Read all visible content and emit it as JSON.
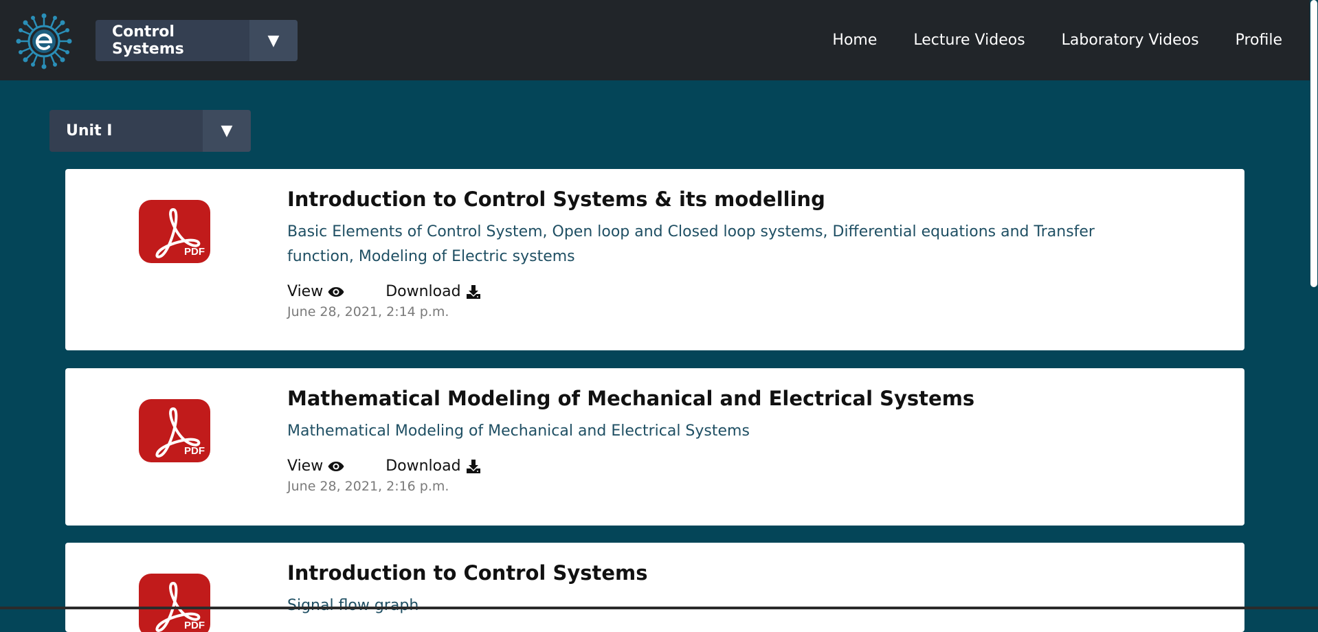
{
  "header": {
    "logo_icon": "e-learning-logo-icon",
    "subject_select": {
      "value": "Control Systems",
      "arrow": "▼"
    },
    "nav": [
      {
        "label": "Home"
      },
      {
        "label": "Lecture Videos"
      },
      {
        "label": "Laboratory Videos"
      },
      {
        "label": "Profile"
      }
    ]
  },
  "unit_select": {
    "value": "Unit I",
    "arrow": "▼"
  },
  "documents": [
    {
      "icon": "pdf-icon",
      "title": "Introduction to Control Systems & its modelling",
      "description": "Basic Elements of Control System, Open loop and Closed loop systems, Differential equations and Transfer function, Modeling of Electric systems",
      "view_label": "View",
      "download_label": "Download",
      "date": "June 28, 2021, 2:14 p.m."
    },
    {
      "icon": "pdf-icon",
      "title": "Mathematical Modeling of Mechanical and Electrical Systems",
      "description": "Mathematical Modeling of Mechanical and Electrical Systems",
      "view_label": "View",
      "download_label": "Download",
      "date": "June 28, 2021, 2:16 p.m."
    },
    {
      "icon": "pdf-icon",
      "title": "Introduction to Control Systems",
      "description": "Signal flow graph"
    }
  ],
  "colors": {
    "header_bg": "#212529",
    "page_bg": "#044558",
    "select_bg": "#343f51",
    "pdf_red": "#c11b1b",
    "description_text": "#1f4f63"
  }
}
